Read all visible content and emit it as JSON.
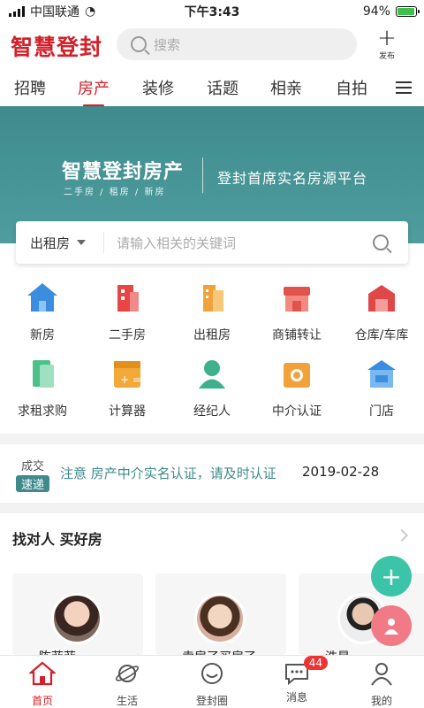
{
  "status_bar": {
    "carrier": "中国联通",
    "time": "下午3:43",
    "battery": "94%"
  },
  "header": {
    "logo": "智慧登封",
    "search_placeholder": "搜索",
    "publish_label": "发布"
  },
  "tabs": [
    "招聘",
    "房产",
    "装修",
    "话题",
    "相亲",
    "自拍"
  ],
  "active_tab": "房产",
  "banner": {
    "title": "智慧登封房产",
    "subtitle": "二手房 / 租房 / 新房",
    "slogan": "登封首席实名房源平台"
  },
  "filter": {
    "selected": "出租房",
    "placeholder": "请输入相关的关键词"
  },
  "categories": [
    {
      "label": "新房",
      "icon": "house-icon",
      "color": "#3b8de0"
    },
    {
      "label": "二手房",
      "icon": "building-icon",
      "color": "#e84545"
    },
    {
      "label": "出租房",
      "icon": "apartment-icon",
      "color": "#f2a23a"
    },
    {
      "label": "商铺转让",
      "icon": "shop-icon",
      "color": "#e0544b"
    },
    {
      "label": "仓库/车库",
      "icon": "warehouse-icon",
      "color": "#e04848"
    },
    {
      "label": "求租求购",
      "icon": "document-icon",
      "color": "#4cc08a"
    },
    {
      "label": "计算器",
      "icon": "calculator-icon",
      "color": "#f3a93a"
    },
    {
      "label": "经纪人",
      "icon": "agent-icon",
      "color": "#3fb08c"
    },
    {
      "label": "中介认证",
      "icon": "certification-icon",
      "color": "#f2a23a"
    },
    {
      "label": "门店",
      "icon": "store-icon",
      "color": "#3b8de0"
    }
  ],
  "news": {
    "badge_top": "成交",
    "badge_bottom": "速递",
    "text": "注意 房产中介实名认证，请及时认证",
    "date": "2019-02-28"
  },
  "agents": {
    "title": "找对人 买好房",
    "cards": [
      {
        "name": "陈菲菲"
      },
      {
        "name": "卖房了买房了"
      },
      {
        "name": "浩星"
      }
    ]
  },
  "bottom_nav": [
    {
      "label": "首页",
      "icon": "home-icon"
    },
    {
      "label": "生活",
      "icon": "planet-icon"
    },
    {
      "label": "登封圈",
      "icon": "circle-icon"
    },
    {
      "label": "消息",
      "icon": "message-icon",
      "count": "44"
    },
    {
      "label": "我的",
      "icon": "profile-icon"
    }
  ],
  "accent_color": "#d4202a",
  "theme_color": "#3f8b8c"
}
